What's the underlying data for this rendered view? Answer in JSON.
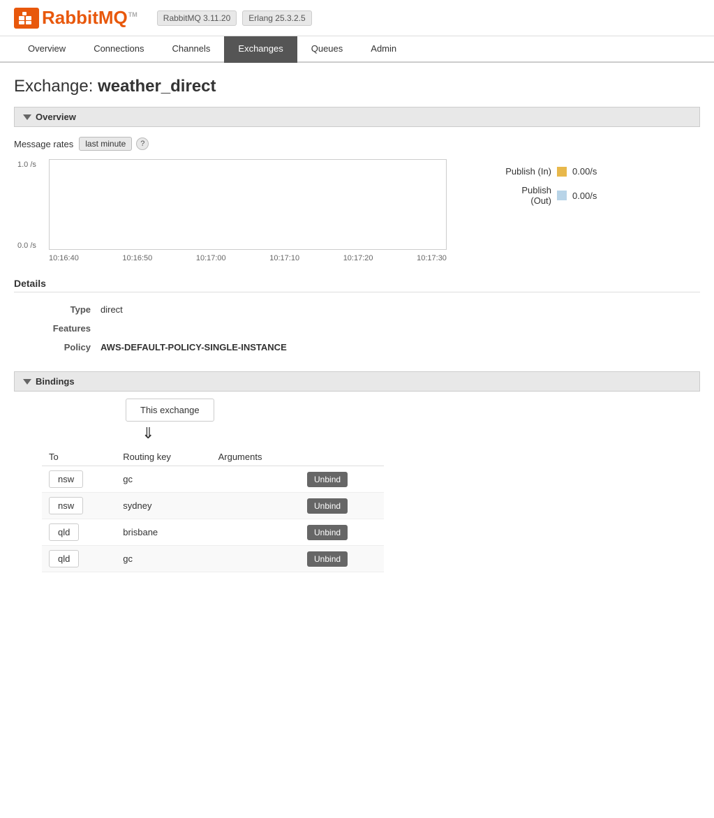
{
  "header": {
    "logo_text_rabbit": "Rabbit",
    "logo_text_mq": "MQ",
    "logo_tm": "TM",
    "version": "RabbitMQ 3.11.20",
    "erlang": "Erlang 25.3.2.5"
  },
  "nav": {
    "items": [
      {
        "label": "Overview",
        "active": false
      },
      {
        "label": "Connections",
        "active": false
      },
      {
        "label": "Channels",
        "active": false
      },
      {
        "label": "Exchanges",
        "active": true
      },
      {
        "label": "Queues",
        "active": false
      },
      {
        "label": "Admin",
        "active": false
      }
    ]
  },
  "page": {
    "title_prefix": "Exchange: ",
    "title_name": "weather_direct"
  },
  "overview_section": {
    "label": "Overview",
    "message_rates_label": "Message rates",
    "rates_period": "last minute",
    "help": "?",
    "chart": {
      "y_top": "1.0 /s",
      "y_bottom": "0.0 /s",
      "x_labels": [
        "10:16:40",
        "10:16:50",
        "10:17:00",
        "10:17:10",
        "10:17:20",
        "10:17:30"
      ]
    },
    "legend": [
      {
        "label": "Publish (In)",
        "color": "#e8b84b",
        "value": "0.00/s"
      },
      {
        "label": "Publish\n(Out)",
        "value": "0.00/s",
        "color": "#b8d4e8"
      }
    ]
  },
  "details_section": {
    "title": "Details",
    "rows": [
      {
        "label": "Type",
        "value": "direct"
      },
      {
        "label": "Features",
        "value": ""
      },
      {
        "label": "Policy",
        "value": "AWS-DEFAULT-POLICY-SINGLE-INSTANCE"
      }
    ]
  },
  "bindings_section": {
    "label": "Bindings",
    "exchange_box": "This exchange",
    "arrow": "⇓",
    "table": {
      "headers": [
        "To",
        "Routing key",
        "Arguments",
        ""
      ],
      "rows": [
        {
          "to": "nsw",
          "routing_key": "gc",
          "arguments": "",
          "action": "Unbind"
        },
        {
          "to": "nsw",
          "routing_key": "sydney",
          "arguments": "",
          "action": "Unbind"
        },
        {
          "to": "qld",
          "routing_key": "brisbane",
          "arguments": "",
          "action": "Unbind"
        },
        {
          "to": "qld",
          "routing_key": "gc",
          "arguments": "",
          "action": "Unbind"
        }
      ]
    }
  }
}
